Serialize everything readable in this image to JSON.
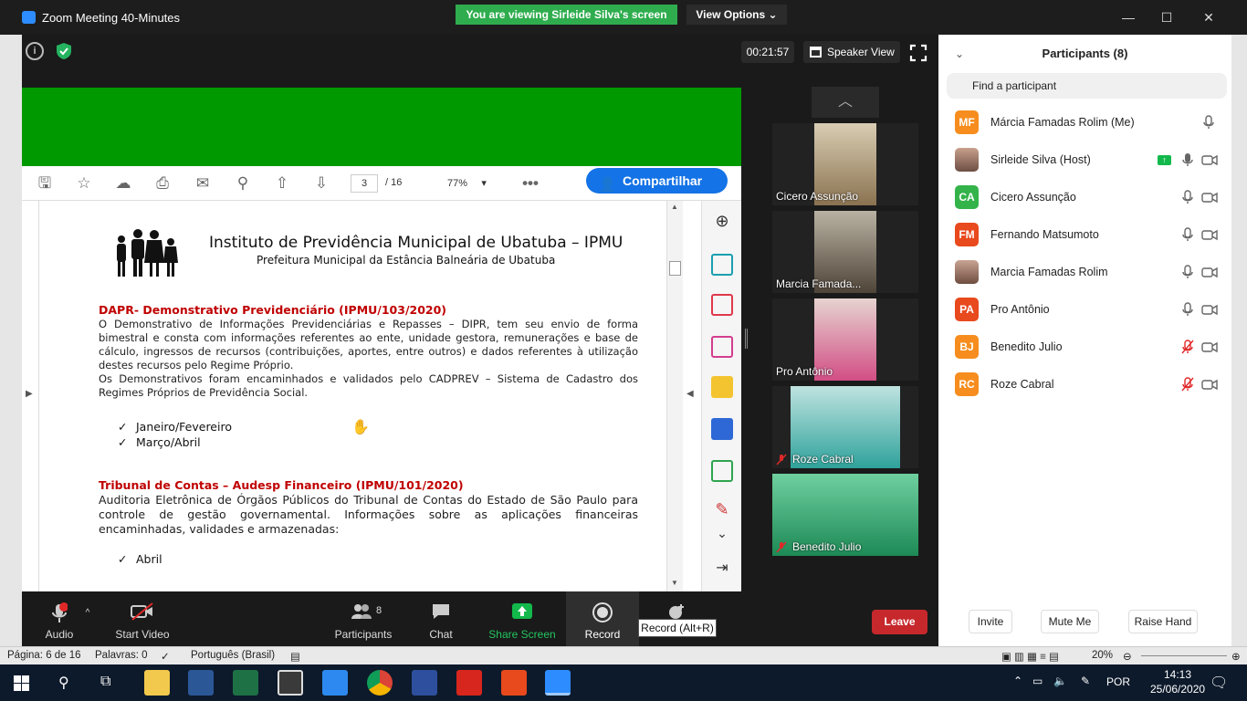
{
  "window": {
    "title": "Zoom Meeting 40-Minutes",
    "viewing_banner": "You are viewing Sirleide Silva's screen",
    "view_options": "View Options"
  },
  "meeting": {
    "timer": "00:21:57",
    "speaker_view": "Speaker View"
  },
  "pdf_toolbar": {
    "page_current": "3",
    "page_total": "/ 16",
    "zoom": "77%",
    "share_button": "Compartilhar"
  },
  "document": {
    "title": "Instituto de Previdência Municipal de Ubatuba – IPMU",
    "subtitle": "Prefeitura Municipal da Estância Balneária de Ubatuba",
    "section1_heading": "DAPR- Demonstrativo Previdenciário (IPMU/103/2020)",
    "section1_para1": "O Demonstrativo de Informações Previdenciárias e Repasses – DIPR, tem seu envio de forma bimestral e consta com informações referentes ao ente, unidade gestora, remunerações e base de cálculo, ingressos de recursos (contribuições, aportes, entre outros) e dados referentes à utilização destes recursos pelo Regime Próprio.",
    "section1_para2": "Os Demonstrativos foram encaminhados e validados pelo CADPREV – Sistema de Cadastro dos Regimes Próprios de Previdência Social.",
    "section1_items": [
      "Janeiro/Fevereiro",
      "Março/Abril"
    ],
    "section2_heading": "Tribunal de Contas – Audesp Financeiro (IPMU/101/2020)",
    "section2_para": "Auditoria Eletrônica de Órgãos Públicos do Tribunal de Contas do Estado de São Paulo para controle de gestão governamental. Informações sobre as aplicações financeiras encaminhadas, validades e armazenadas:",
    "section2_items": [
      "Abril"
    ]
  },
  "video_tiles": [
    {
      "name": "Cicero Assunção",
      "muted": false
    },
    {
      "name": "Marcia Famada...",
      "muted": false
    },
    {
      "name": "Pro Antônio",
      "muted": false
    },
    {
      "name": "Roze Cabral",
      "muted": true
    },
    {
      "name": "Benedito Julio",
      "muted": true
    }
  ],
  "bottom_toolbar": {
    "audio": "Audio",
    "start_video": "Start Video",
    "participants": "Participants",
    "participants_count": "8",
    "chat": "Chat",
    "share_screen": "Share Screen",
    "record": "Record",
    "record_tooltip": "Record (Alt+R)",
    "leave": "Leave"
  },
  "participants_panel": {
    "title": "Participants (8)",
    "search_placeholder": "Find a participant",
    "participants": [
      {
        "initials": "MF",
        "name": "Márcia Famadas Rolim (Me)",
        "color": "#f68d1e",
        "mic": "on",
        "video": false
      },
      {
        "initials": "",
        "name": "Sirleide Silva (Host)",
        "color": "#8a6f63",
        "mic": "on",
        "video": true,
        "sharing": true
      },
      {
        "initials": "CA",
        "name": "Cicero Assunção",
        "color": "#34b34a",
        "mic": "on",
        "video": true
      },
      {
        "initials": "FM",
        "name": "Fernando Matsumoto",
        "color": "#e8491d",
        "mic": "on",
        "video": true
      },
      {
        "initials": "",
        "name": "Marcia Famadas Rolim",
        "color": "#9b7c6e",
        "mic": "on",
        "video": true
      },
      {
        "initials": "PA",
        "name": "Pro Antônio",
        "color": "#e8491d",
        "mic": "on",
        "video": true
      },
      {
        "initials": "BJ",
        "name": "Benedito Julio",
        "color": "#f68d1e",
        "mic": "muted",
        "video": true
      },
      {
        "initials": "RC",
        "name": "Roze Cabral",
        "color": "#f68d1e",
        "mic": "muted",
        "video": true
      }
    ],
    "invite": "Invite",
    "mute_me": "Mute Me",
    "raise_hand": "Raise Hand"
  },
  "word_statusbar": {
    "page": "Página: 6 de 16",
    "words": "Palavras: 0",
    "language": "Português (Brasil)",
    "zoom": "20%"
  },
  "taskbar": {
    "language": "POR",
    "time": "14:13",
    "date": "25/06/2020"
  }
}
